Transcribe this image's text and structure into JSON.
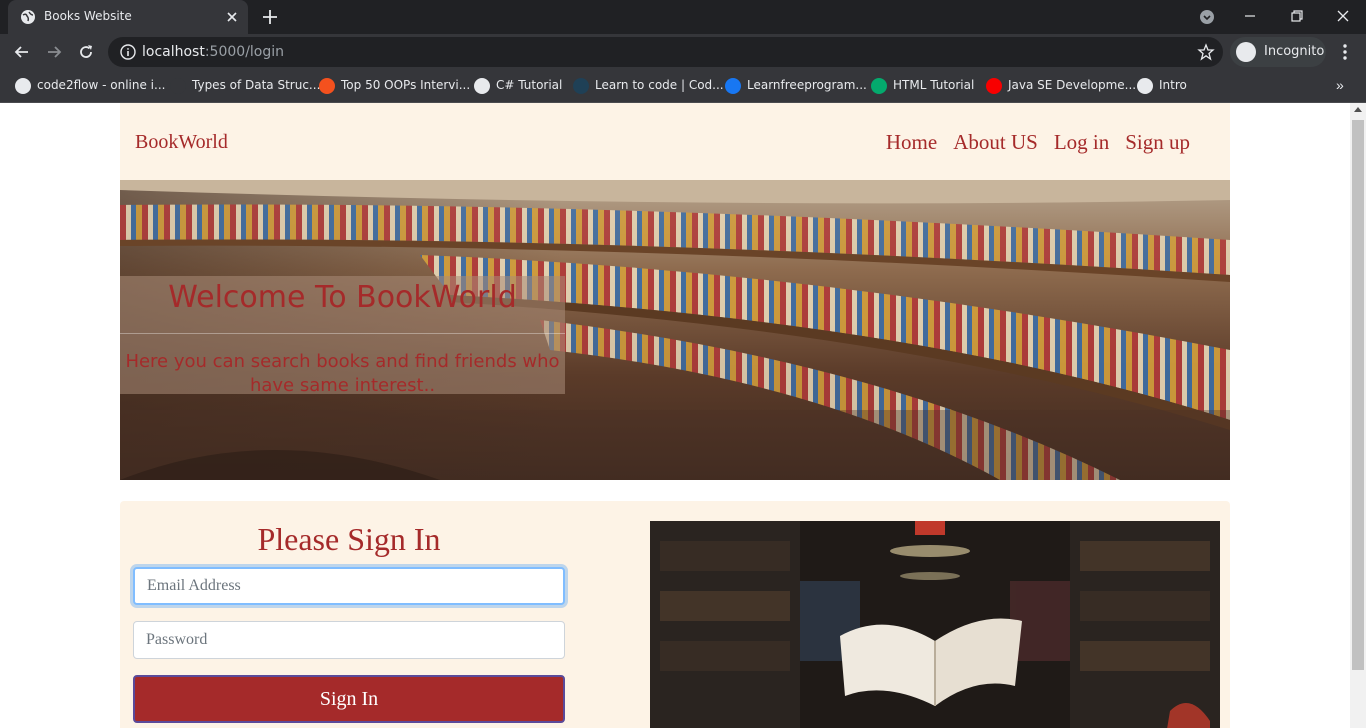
{
  "browser": {
    "tab_title": "Books Website",
    "url_host": "localhost",
    "url_path": ":5000/login",
    "incognito_label": "Incognito",
    "bookmarks": [
      {
        "label": "code2flow - online i...",
        "icon": "globe-icon",
        "color": "#e8eaed"
      },
      {
        "label": "Types of Data Struc...",
        "icon": "blank-page-icon",
        "color": "#35363a"
      },
      {
        "label": "Top 50 OOPs Intervi...",
        "icon": "g-logo-icon",
        "color": "#f4511e"
      },
      {
        "label": "C# Tutorial",
        "icon": "globe-icon",
        "color": "#e8eaed"
      },
      {
        "label": "Learn to code | Cod...",
        "icon": "codecademy-icon",
        "color": "#1f4056"
      },
      {
        "label": "Learnfreeprogram...",
        "icon": "facebook-icon",
        "color": "#1877f2"
      },
      {
        "label": "HTML Tutorial",
        "icon": "w3schools-icon",
        "color": "#04aa6d"
      },
      {
        "label": "Java SE Developme...",
        "icon": "oracle-icon",
        "color": "#f80000"
      },
      {
        "label": "Intro",
        "icon": "globe-icon",
        "color": "#e8eaed"
      }
    ]
  },
  "page": {
    "brand": "BookWorld",
    "nav": [
      "Home",
      "About US",
      "Log in",
      "Sign up"
    ],
    "hero": {
      "title": "Welcome To BookWorld",
      "subtitle": "Here you can search books and find friends who have same interest.."
    },
    "signin": {
      "title": "Please Sign In",
      "email_placeholder": "Email Address",
      "password_placeholder": "Password",
      "button": "Sign In"
    }
  },
  "colors": {
    "accent": "#a52a2a",
    "panel_bg": "#fdf3e6"
  }
}
